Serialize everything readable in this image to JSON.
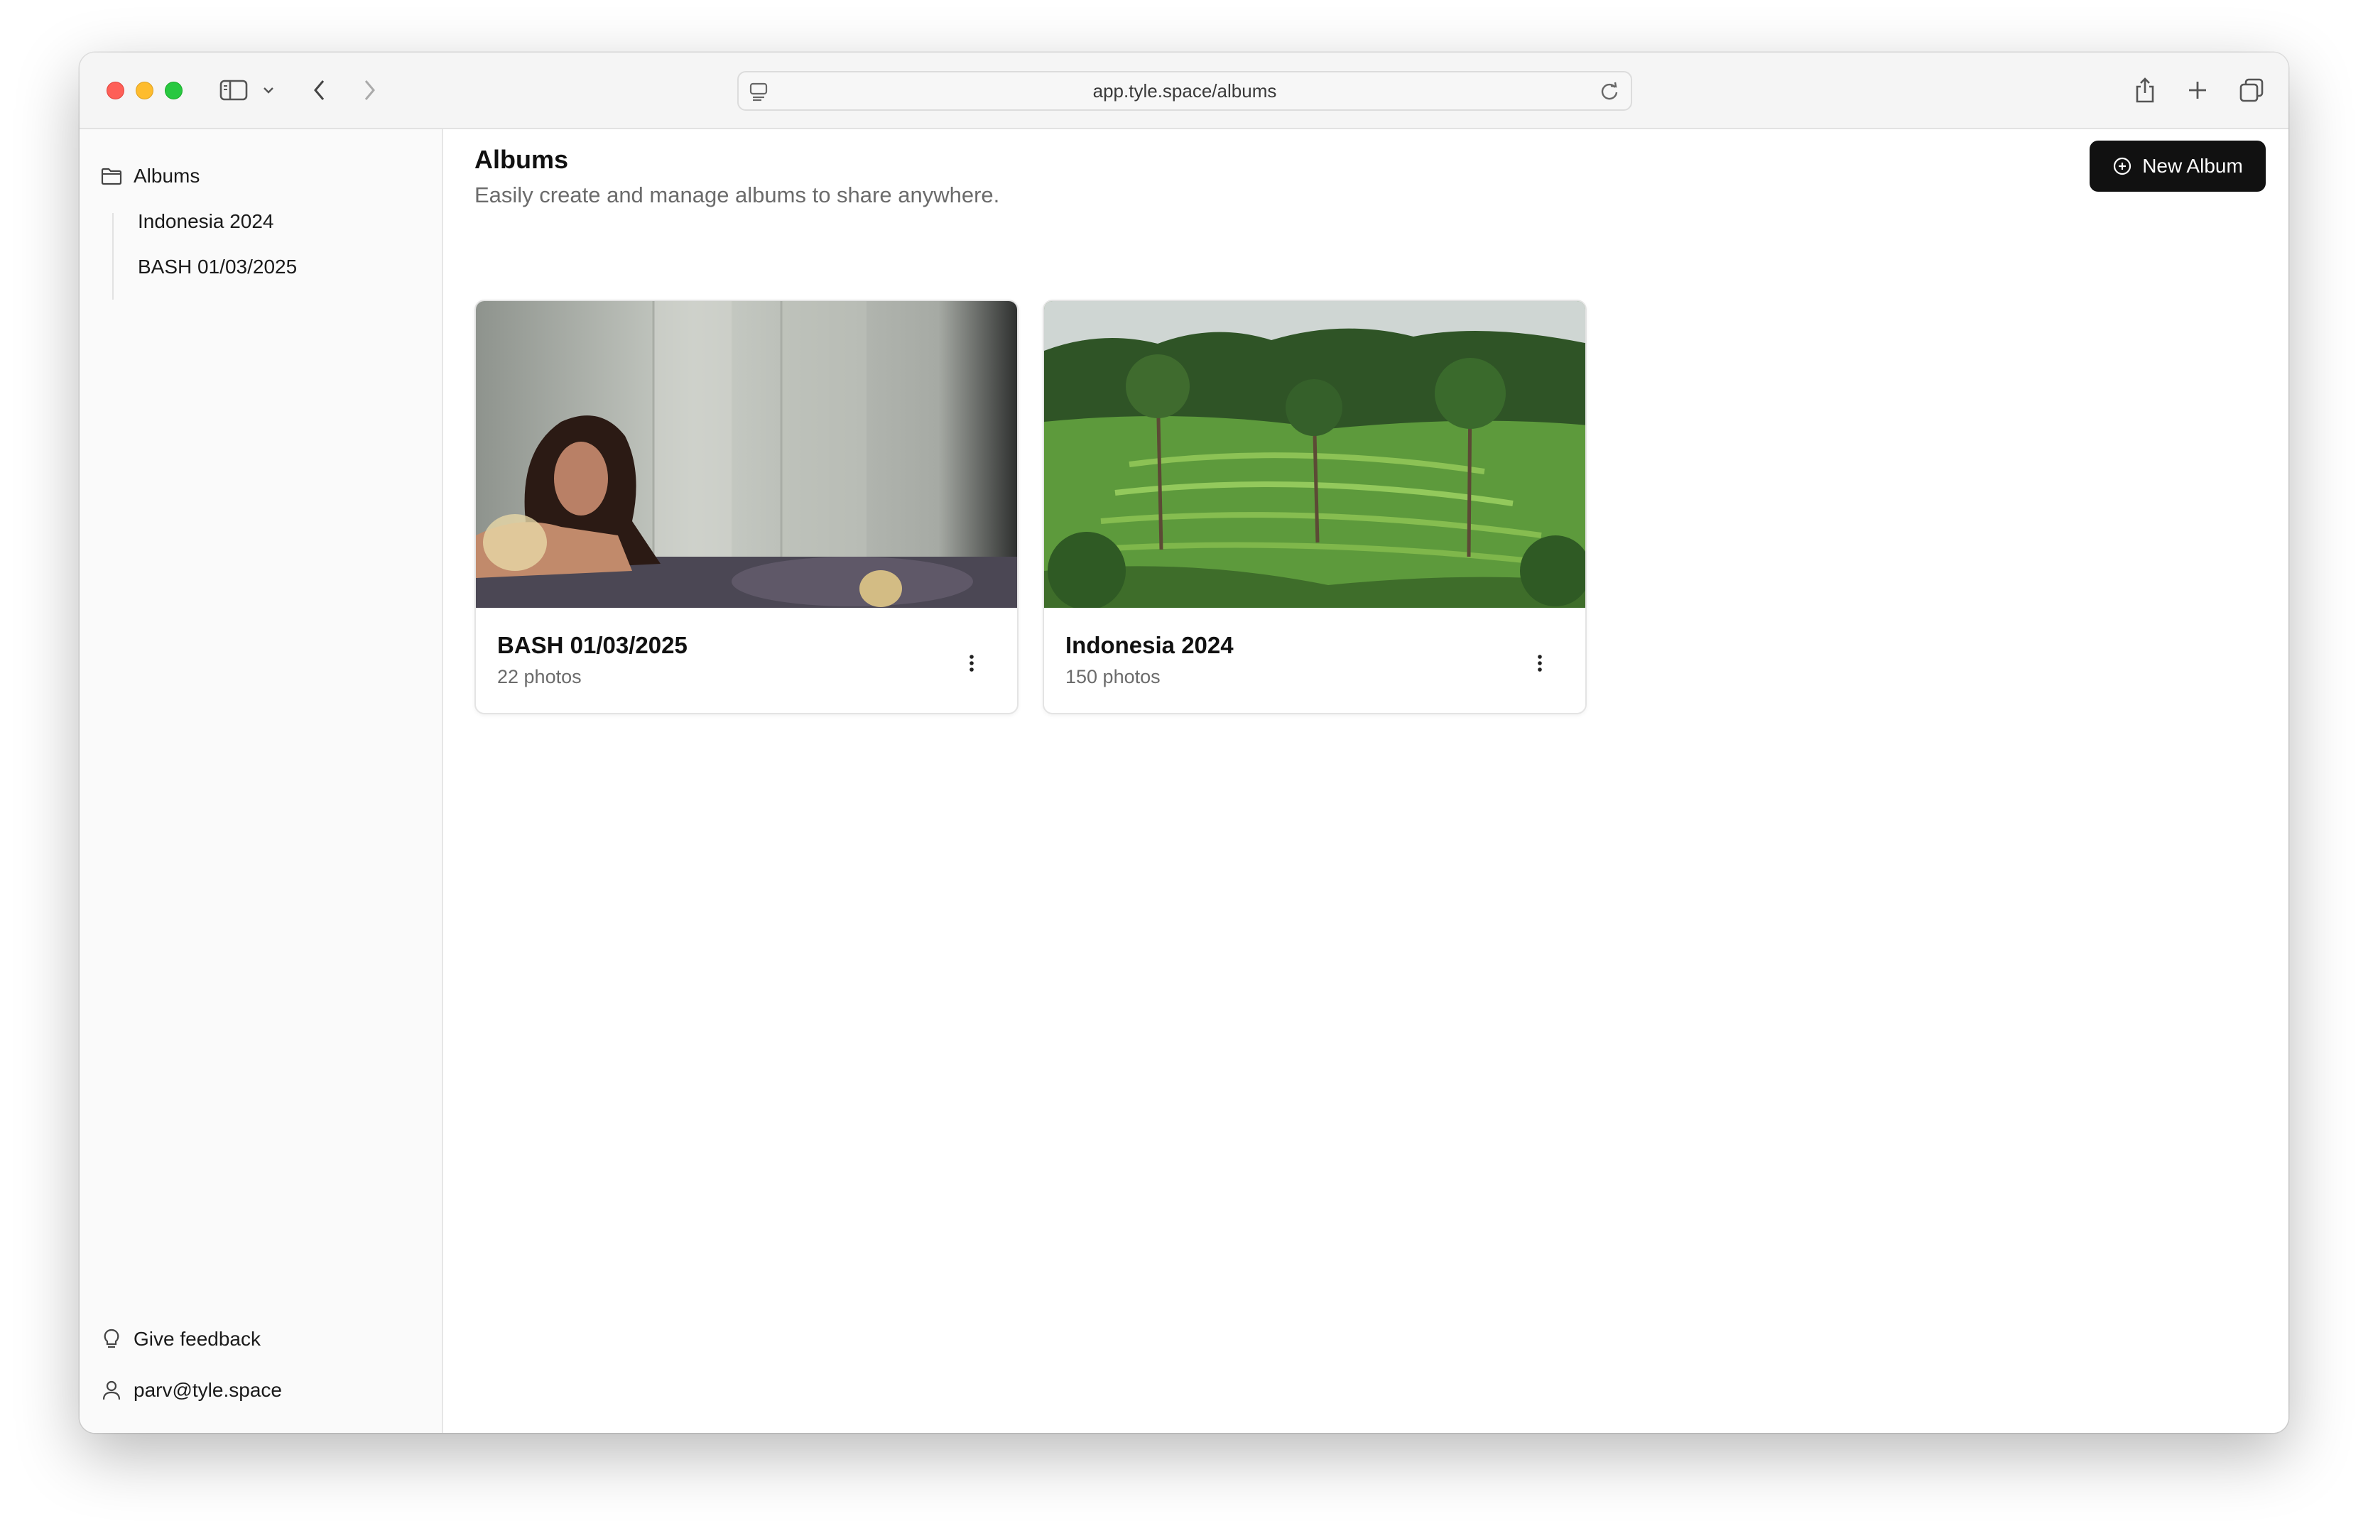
{
  "browser": {
    "url": "app.tyle.space/albums"
  },
  "sidebar": {
    "root_label": "Albums",
    "items": [
      {
        "label": "Indonesia 2024"
      },
      {
        "label": "BASH 01/03/2025"
      }
    ],
    "feedback_label": "Give feedback",
    "user_email": "parv@tyle.space"
  },
  "main": {
    "title": "Albums",
    "subtitle": "Easily create and manage albums to share anywhere.",
    "new_album_label": "New Album",
    "albums": [
      {
        "title": "BASH 01/03/2025",
        "count": "22 photos"
      },
      {
        "title": "Indonesia 2024",
        "count": "150 photos"
      }
    ]
  },
  "icons": {
    "sidebar_toggle": "sidebar-icon",
    "back": "chevron-left-icon",
    "forward": "chevron-right-icon",
    "share": "share-icon",
    "new_tab": "plus-icon",
    "tabs": "tabs-overview-icon",
    "folder": "folder-icon",
    "feedback": "lightbulb-icon",
    "user": "user-icon",
    "new_album": "plus-circle-icon",
    "more": "more-vertical-icon"
  },
  "colors": {
    "button_bg": "#111111",
    "close": "#fe5f57",
    "minimize": "#febc2e",
    "zoom": "#28c840"
  }
}
